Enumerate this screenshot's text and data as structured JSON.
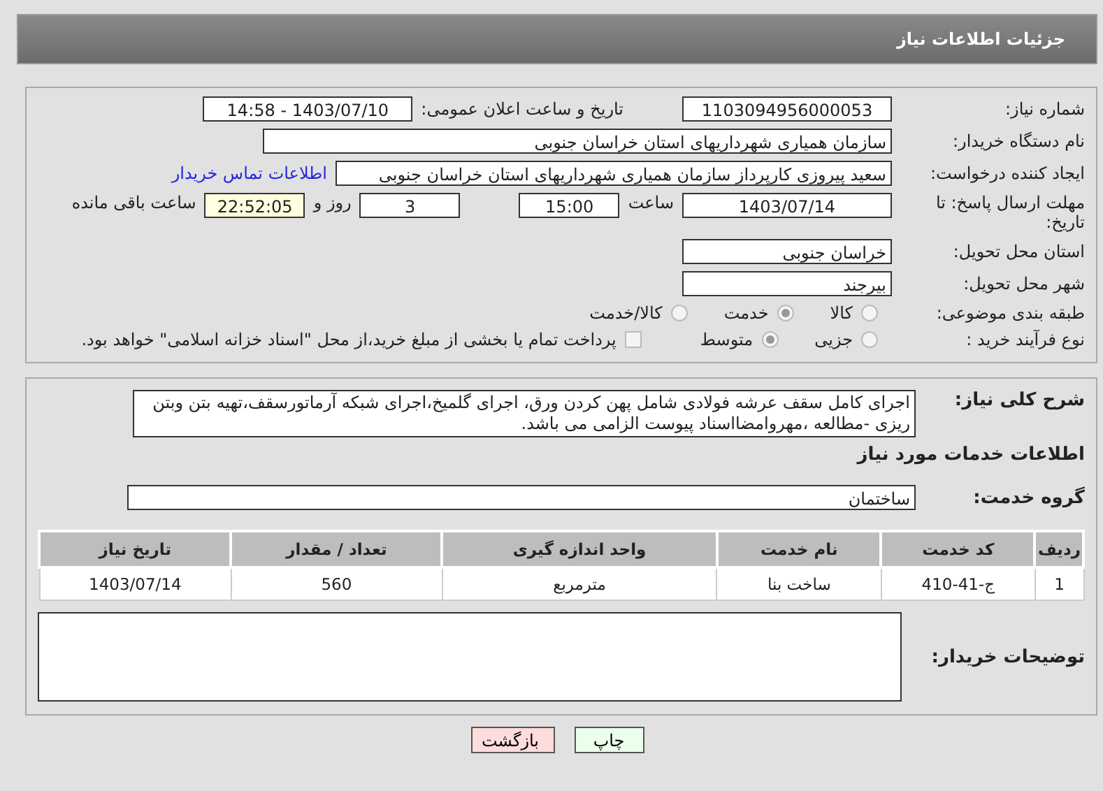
{
  "header": {
    "title": "جزئیات اطلاعات نیاز"
  },
  "details": {
    "need_number": {
      "label": "شماره نیاز:",
      "value": "1103094956000053"
    },
    "announce": {
      "label": "تاریخ و ساعت اعلان عمومی:",
      "value": "1403/07/10 - 14:58"
    },
    "buyer_org": {
      "label": "نام دستگاه خریدار:",
      "value": "سازمان همیاری شهرداریهای استان خراسان جنوبی"
    },
    "requester": {
      "label": "ایجاد کننده درخواست:",
      "value": "سعید پیروزی کارپرداز سازمان همیاری شهرداریهای استان خراسان جنوبی",
      "link": "اطلاعات تماس خریدار"
    },
    "deadline": {
      "label": "مهلت ارسال پاسخ: تا تاریخ:",
      "date": "1403/07/14",
      "time_label": "ساعت",
      "time": "15:00",
      "days": "3",
      "days_suffix": "روز و",
      "remaining": "22:52:05",
      "remaining_suffix": "ساعت باقی مانده"
    },
    "province": {
      "label": "استان محل تحویل:",
      "value": "خراسان جنوبی"
    },
    "city": {
      "label": "شهر محل تحویل:",
      "value": "بیرجند"
    },
    "category": {
      "label": "طبقه بندی موضوعی:",
      "options": [
        {
          "label": "کالا",
          "selected": false
        },
        {
          "label": "خدمت",
          "selected": true
        },
        {
          "label": "کالا/خدمت",
          "selected": false
        }
      ]
    },
    "process": {
      "label": "نوع فرآیند خرید :",
      "options": [
        {
          "label": "جزیی",
          "selected": false
        },
        {
          "label": "متوسط",
          "selected": true
        }
      ],
      "payment": {
        "label": "پرداخت تمام یا بخشی از مبلغ خرید،از محل \"اسناد خزانه اسلامی\" خواهد بود.",
        "checked": false
      }
    }
  },
  "description": {
    "label": "شرح کلی نیاز:",
    "value": "اجرای کامل سقف عرشه فولادی شامل پهن کردن ورق، اجرای گلمیخ،اجرای شبکه آرماتورسقف،تهیه بتن وبتن ریزی -مطالعه ،مهروامضااسناد پیوست الزامی می باشد."
  },
  "services_title": "اطلاعات خدمات مورد نیاز",
  "service_group": {
    "label": "گروه خدمت:",
    "value": "ساختمان"
  },
  "table": {
    "columns": [
      "ردیف",
      "کد خدمت",
      "نام خدمت",
      "واحد اندازه گیری",
      "تعداد / مقدار",
      "تاریخ نیاز"
    ],
    "rows": [
      [
        "1",
        "ج-41-410",
        "ساخت بنا",
        "مترمربع",
        "560",
        "1403/07/14"
      ]
    ]
  },
  "buyer_notes": {
    "label": "توضیحات خریدار:"
  },
  "buttons": [
    {
      "label": "چاپ",
      "kind": "print"
    },
    {
      "label": "بازگشت",
      "kind": "back"
    }
  ]
}
